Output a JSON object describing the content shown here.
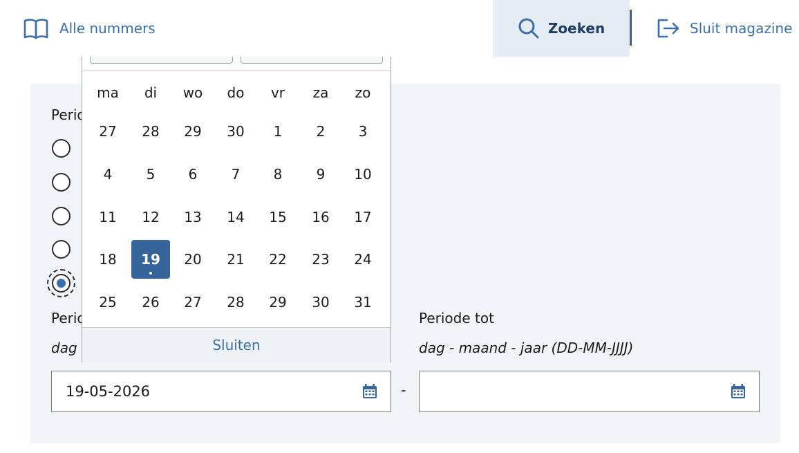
{
  "nav": {
    "issues_label": "Alle nummers",
    "search_label": "Zoeken",
    "close_label": "Sluit magazine"
  },
  "filter": {
    "period_heading": "Periode",
    "period_from_label": "Periode van",
    "period_to_label": "Periode tot",
    "format_hint": "dag - maand - jaar",
    "format_code": "(DD-MM-JJJJ)",
    "from_value": "19-05-2026",
    "to_value": "",
    "separator": "-",
    "selected_radio_index": 4
  },
  "datepicker": {
    "weekdays": [
      "ma",
      "di",
      "wo",
      "do",
      "vr",
      "za",
      "zo"
    ],
    "weeks": [
      [
        "27",
        "28",
        "29",
        "30",
        "1",
        "2",
        "3"
      ],
      [
        "4",
        "5",
        "6",
        "7",
        "8",
        "9",
        "10"
      ],
      [
        "11",
        "12",
        "13",
        "14",
        "15",
        "16",
        "17"
      ],
      [
        "18",
        "19",
        "20",
        "21",
        "22",
        "23",
        "24"
      ],
      [
        "25",
        "26",
        "27",
        "28",
        "29",
        "30",
        "31"
      ]
    ],
    "today_week": 3,
    "today_col": 1,
    "close_label": "Sluiten"
  },
  "colors": {
    "brand_blue": "#3a6fa8",
    "today_bg": "#35659b",
    "panel_bg": "#f1f4f8"
  },
  "icons": {
    "issues": "open-book-icon",
    "search": "magnifier-icon",
    "close": "exit-arrow-icon",
    "calendar": "calendar-icon"
  }
}
